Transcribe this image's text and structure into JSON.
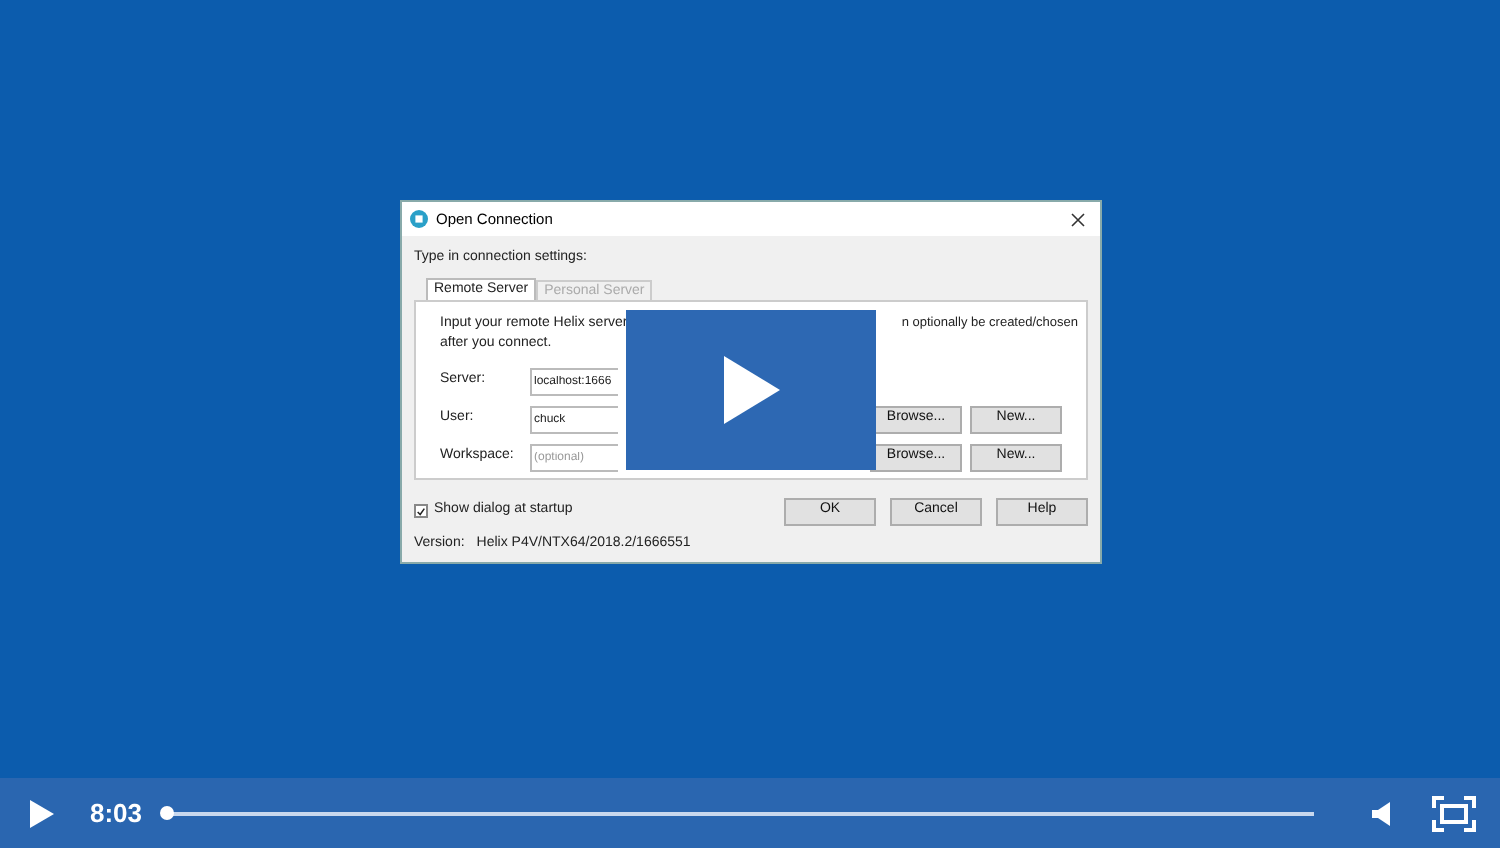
{
  "dialog": {
    "title": "Open Connection",
    "prompt": "Type in connection settings:",
    "tabs": [
      {
        "label": "Remote Server",
        "selected": true
      },
      {
        "label": "Personal Server",
        "selected": false
      }
    ],
    "description": {
      "start": "Input your remote Helix server",
      "end": "n optionally be created/chosen",
      "line_2": "after you connect."
    },
    "fields": [
      {
        "label": "Server:",
        "value": "localhost:1666"
      },
      {
        "label": "User:",
        "value": "chuck",
        "buttons": [
          "Browse...",
          "New..."
        ]
      },
      {
        "label": "Workspace:",
        "placeholder": "(optional)",
        "buttons": [
          "Browse...",
          "New..."
        ]
      }
    ],
    "show_dialog_at_startup": {
      "label": "Show dialog at startup",
      "checked": true
    },
    "buttons": [
      "OK",
      "Cancel",
      "Help"
    ],
    "version": {
      "label": "Version:",
      "value": "Helix P4V/NTX64/2018.2/1666551"
    }
  },
  "player": {
    "time": "8:03",
    "level": 0
  }
}
